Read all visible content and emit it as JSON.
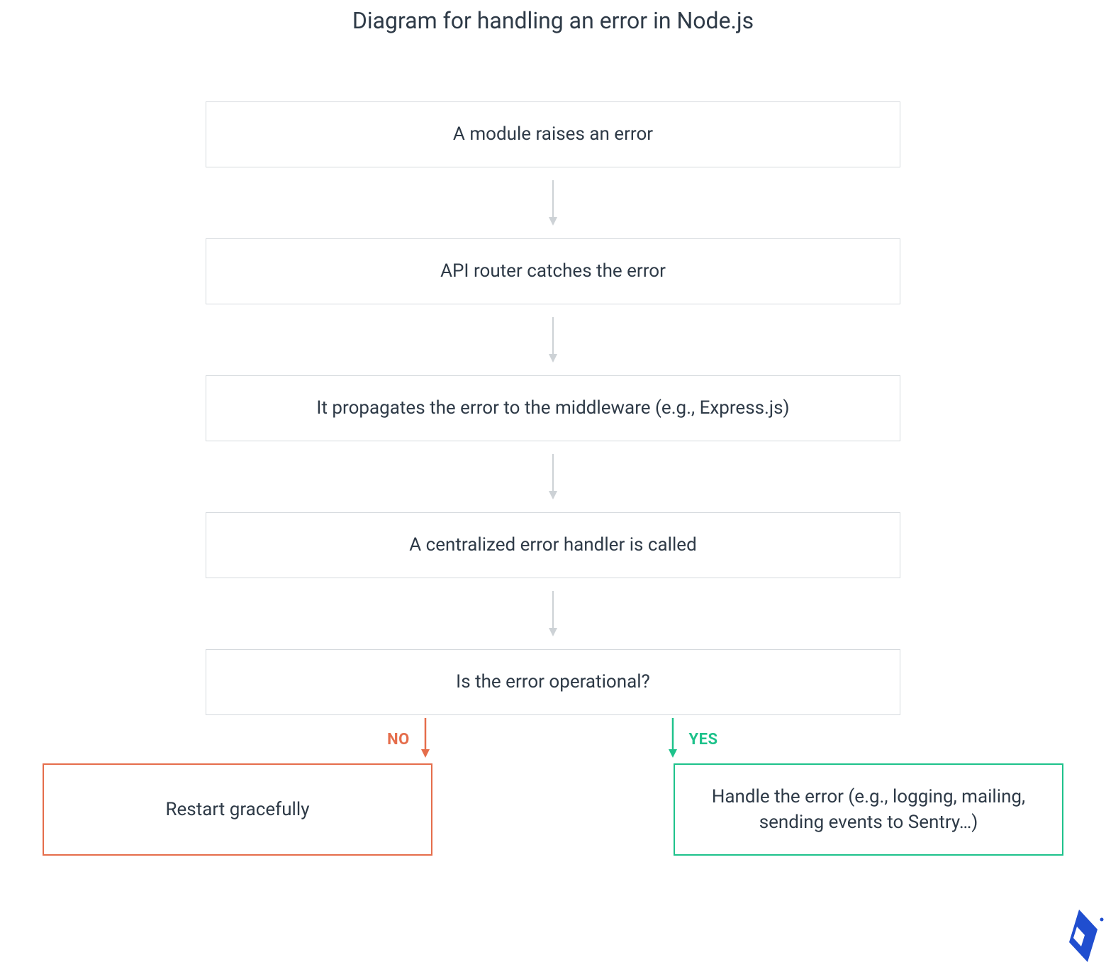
{
  "title": "Diagram for handling an error in Node.js",
  "steps": [
    "A module raises an error",
    "API router catches the error",
    "It propagates the error to the middleware (e.g., Express.js)",
    "A centralized error handler is called",
    "Is the error operational?"
  ],
  "branches": {
    "no": {
      "label": "NO",
      "result": "Restart gracefully",
      "color": "#e56d4b"
    },
    "yes": {
      "label": "YES",
      "result": "Handle the error (e.g., logging, mailing, sending events to Sentry…)",
      "color": "#1ec28b"
    }
  },
  "colors": {
    "text": "#2e3a47",
    "border_gray": "#d6dade",
    "arrow_gray": "#cdd2d6",
    "no": "#e56d4b",
    "yes": "#1ec28b",
    "logo": "#204ecf"
  }
}
